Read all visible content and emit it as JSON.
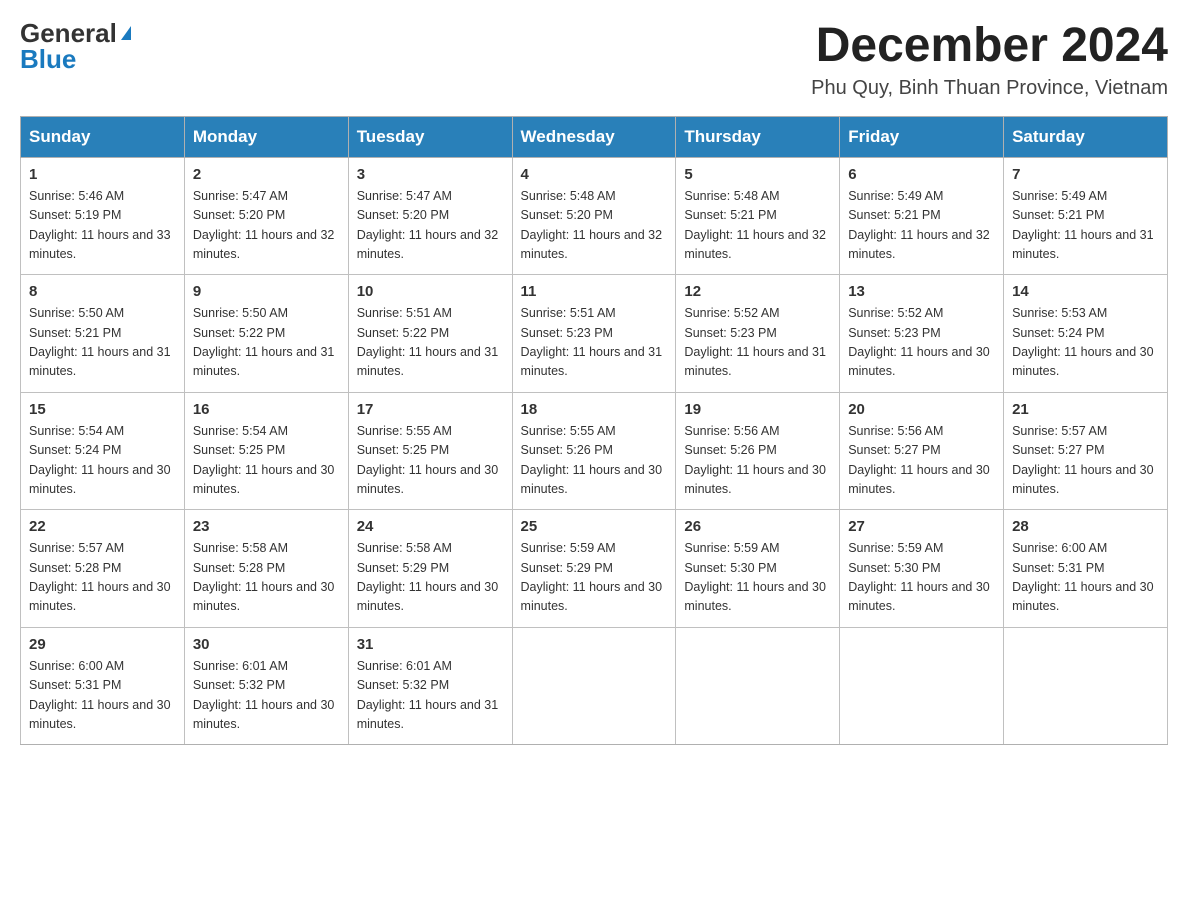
{
  "header": {
    "logo_general": "General",
    "logo_blue": "Blue",
    "title": "December 2024",
    "subtitle": "Phu Quy, Binh Thuan Province, Vietnam"
  },
  "days_of_week": [
    "Sunday",
    "Monday",
    "Tuesday",
    "Wednesday",
    "Thursday",
    "Friday",
    "Saturday"
  ],
  "weeks": [
    [
      {
        "day": "1",
        "sunrise": "5:46 AM",
        "sunset": "5:19 PM",
        "daylight": "11 hours and 33 minutes."
      },
      {
        "day": "2",
        "sunrise": "5:47 AM",
        "sunset": "5:20 PM",
        "daylight": "11 hours and 32 minutes."
      },
      {
        "day": "3",
        "sunrise": "5:47 AM",
        "sunset": "5:20 PM",
        "daylight": "11 hours and 32 minutes."
      },
      {
        "day": "4",
        "sunrise": "5:48 AM",
        "sunset": "5:20 PM",
        "daylight": "11 hours and 32 minutes."
      },
      {
        "day": "5",
        "sunrise": "5:48 AM",
        "sunset": "5:21 PM",
        "daylight": "11 hours and 32 minutes."
      },
      {
        "day": "6",
        "sunrise": "5:49 AM",
        "sunset": "5:21 PM",
        "daylight": "11 hours and 32 minutes."
      },
      {
        "day": "7",
        "sunrise": "5:49 AM",
        "sunset": "5:21 PM",
        "daylight": "11 hours and 31 minutes."
      }
    ],
    [
      {
        "day": "8",
        "sunrise": "5:50 AM",
        "sunset": "5:21 PM",
        "daylight": "11 hours and 31 minutes."
      },
      {
        "day": "9",
        "sunrise": "5:50 AM",
        "sunset": "5:22 PM",
        "daylight": "11 hours and 31 minutes."
      },
      {
        "day": "10",
        "sunrise": "5:51 AM",
        "sunset": "5:22 PM",
        "daylight": "11 hours and 31 minutes."
      },
      {
        "day": "11",
        "sunrise": "5:51 AM",
        "sunset": "5:23 PM",
        "daylight": "11 hours and 31 minutes."
      },
      {
        "day": "12",
        "sunrise": "5:52 AM",
        "sunset": "5:23 PM",
        "daylight": "11 hours and 31 minutes."
      },
      {
        "day": "13",
        "sunrise": "5:52 AM",
        "sunset": "5:23 PM",
        "daylight": "11 hours and 30 minutes."
      },
      {
        "day": "14",
        "sunrise": "5:53 AM",
        "sunset": "5:24 PM",
        "daylight": "11 hours and 30 minutes."
      }
    ],
    [
      {
        "day": "15",
        "sunrise": "5:54 AM",
        "sunset": "5:24 PM",
        "daylight": "11 hours and 30 minutes."
      },
      {
        "day": "16",
        "sunrise": "5:54 AM",
        "sunset": "5:25 PM",
        "daylight": "11 hours and 30 minutes."
      },
      {
        "day": "17",
        "sunrise": "5:55 AM",
        "sunset": "5:25 PM",
        "daylight": "11 hours and 30 minutes."
      },
      {
        "day": "18",
        "sunrise": "5:55 AM",
        "sunset": "5:26 PM",
        "daylight": "11 hours and 30 minutes."
      },
      {
        "day": "19",
        "sunrise": "5:56 AM",
        "sunset": "5:26 PM",
        "daylight": "11 hours and 30 minutes."
      },
      {
        "day": "20",
        "sunrise": "5:56 AM",
        "sunset": "5:27 PM",
        "daylight": "11 hours and 30 minutes."
      },
      {
        "day": "21",
        "sunrise": "5:57 AM",
        "sunset": "5:27 PM",
        "daylight": "11 hours and 30 minutes."
      }
    ],
    [
      {
        "day": "22",
        "sunrise": "5:57 AM",
        "sunset": "5:28 PM",
        "daylight": "11 hours and 30 minutes."
      },
      {
        "day": "23",
        "sunrise": "5:58 AM",
        "sunset": "5:28 PM",
        "daylight": "11 hours and 30 minutes."
      },
      {
        "day": "24",
        "sunrise": "5:58 AM",
        "sunset": "5:29 PM",
        "daylight": "11 hours and 30 minutes."
      },
      {
        "day": "25",
        "sunrise": "5:59 AM",
        "sunset": "5:29 PM",
        "daylight": "11 hours and 30 minutes."
      },
      {
        "day": "26",
        "sunrise": "5:59 AM",
        "sunset": "5:30 PM",
        "daylight": "11 hours and 30 minutes."
      },
      {
        "day": "27",
        "sunrise": "5:59 AM",
        "sunset": "5:30 PM",
        "daylight": "11 hours and 30 minutes."
      },
      {
        "day": "28",
        "sunrise": "6:00 AM",
        "sunset": "5:31 PM",
        "daylight": "11 hours and 30 minutes."
      }
    ],
    [
      {
        "day": "29",
        "sunrise": "6:00 AM",
        "sunset": "5:31 PM",
        "daylight": "11 hours and 30 minutes."
      },
      {
        "day": "30",
        "sunrise": "6:01 AM",
        "sunset": "5:32 PM",
        "daylight": "11 hours and 30 minutes."
      },
      {
        "day": "31",
        "sunrise": "6:01 AM",
        "sunset": "5:32 PM",
        "daylight": "11 hours and 31 minutes."
      },
      null,
      null,
      null,
      null
    ]
  ],
  "sunrise_label": "Sunrise:",
  "sunset_label": "Sunset:",
  "daylight_label": "Daylight:"
}
